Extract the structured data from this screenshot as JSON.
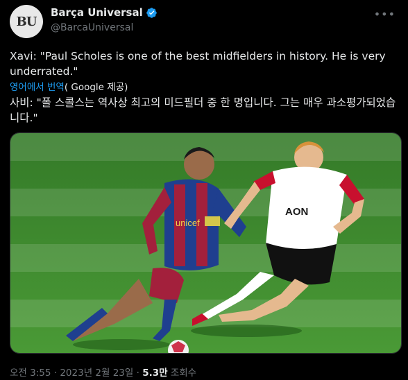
{
  "author": {
    "avatar_text": "BU",
    "display_name": "Barça Universal",
    "handle": "@BarcaUniversal",
    "verified": true,
    "verified_color": "#1d9bf0"
  },
  "tweet": {
    "text": "Xavi: \"Paul Scholes is one of the best midfielders in history. He is very underrated.\"",
    "translate_link": "영어에서 번역",
    "translate_suffix": "( Google 제공)",
    "translated_text": "사비: \"폴 스콜스는 역사상 최고의 미드필더 중 한 명입니다. 그는 매우 과소평가되었습니다.\""
  },
  "media": {
    "description_icon": "photo",
    "left_player": {
      "sponsor": "unicef",
      "kit_colors": [
        "#1f3f8f",
        "#a3203c"
      ]
    },
    "right_player": {
      "sponsor": "AON",
      "kit_colors": [
        "#ffffff",
        "#111111",
        "#c8102e"
      ]
    }
  },
  "meta": {
    "time": "오전 3:55",
    "separator": "·",
    "date": "2023년 2월 23일",
    "views_count": "5.3만",
    "views_label": "조회수"
  },
  "colors": {
    "background": "#000000",
    "text_primary": "#e7e9ea",
    "text_secondary": "#71767b",
    "link": "#1d9bf0",
    "pitch": "#3f8a2e"
  }
}
